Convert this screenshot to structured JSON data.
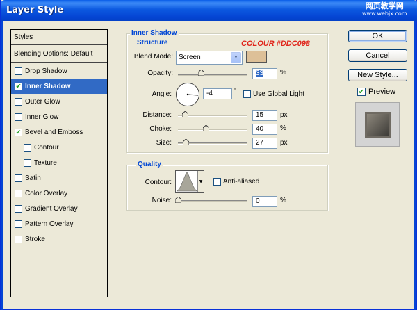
{
  "window": {
    "title": "Layer Style"
  },
  "watermark": {
    "line1": "网页教学网",
    "line2": "www.webjx.com"
  },
  "styles_panel": {
    "header": "Styles",
    "blending": "Blending Options: Default",
    "items": [
      {
        "label": "Drop Shadow",
        "checked": false,
        "selected": false,
        "indent": false
      },
      {
        "label": "Inner Shadow",
        "checked": true,
        "selected": true,
        "indent": false
      },
      {
        "label": "Outer Glow",
        "checked": false,
        "selected": false,
        "indent": false
      },
      {
        "label": "Inner Glow",
        "checked": false,
        "selected": false,
        "indent": false
      },
      {
        "label": "Bevel and Emboss",
        "checked": true,
        "selected": false,
        "indent": false
      },
      {
        "label": "Contour",
        "checked": false,
        "selected": false,
        "indent": true
      },
      {
        "label": "Texture",
        "checked": false,
        "selected": false,
        "indent": true
      },
      {
        "label": "Satin",
        "checked": false,
        "selected": false,
        "indent": false
      },
      {
        "label": "Color Overlay",
        "checked": false,
        "selected": false,
        "indent": false
      },
      {
        "label": "Gradient Overlay",
        "checked": false,
        "selected": false,
        "indent": false
      },
      {
        "label": "Pattern Overlay",
        "checked": false,
        "selected": false,
        "indent": false
      },
      {
        "label": "Stroke",
        "checked": false,
        "selected": false,
        "indent": false
      }
    ]
  },
  "inner_shadow": {
    "title": "Inner Shadow",
    "structure_label": "Structure",
    "colour_note": "COLOUR #DDC098",
    "blend_mode_label": "Blend Mode:",
    "blend_mode_value": "Screen",
    "shadow_color": "#ddc098",
    "opacity_label": "Opacity:",
    "opacity_value": "33",
    "opacity_level": 0.33,
    "angle_label": "Angle:",
    "angle_value": "-4",
    "degree_sign": "°",
    "global_light_label": "Use Global Light",
    "distance_label": "Distance:",
    "distance_value": "15",
    "distance_level": 0.1,
    "choke_label": "Choke:",
    "choke_value": "40",
    "choke_level": 0.4,
    "size_label": "Size:",
    "size_value": "27",
    "size_level": 0.11,
    "unit_px": "px",
    "unit_pct": "%"
  },
  "quality": {
    "title": "Quality",
    "contour_label": "Contour:",
    "anti_aliased_label": "Anti-aliased",
    "noise_label": "Noise:",
    "noise_value": "0",
    "noise_level": 0,
    "unit_pct": "%"
  },
  "buttons": {
    "ok": "OK",
    "cancel": "Cancel",
    "new_style": "New Style...",
    "preview_label": "Preview"
  },
  "colors": {
    "accent": "#316ac5",
    "title_bar": "#0545d4",
    "group_label": "#0046d5",
    "note": "#e0251b"
  }
}
